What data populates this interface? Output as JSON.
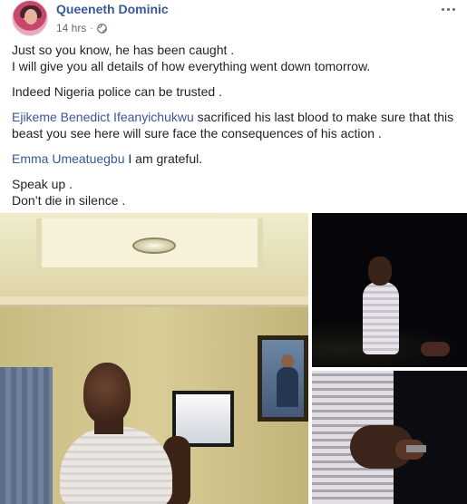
{
  "post": {
    "author": "Queeneth Dominic",
    "timestamp": "14 hrs",
    "separator": "·",
    "privacy_icon": "globe-icon",
    "more_icon": "more-options-icon",
    "body": {
      "p1_line1": "Just so you know, he has been caught .",
      "p1_line2": "I will give you all details of how everything went down tomorrow.",
      "p2": "Indeed Nigeria police can be trusted .",
      "p3_mention": "Ejikeme Benedict Ifeanyichukwu",
      "p3_text_a": " sacrificed his last blood to make sure that this",
      "p3_text_b": "beast you see here will sure face the consequences of his action .",
      "p4_mention": "Emma Umeatuegbu",
      "p4_text": " I am grateful.",
      "p5_line1": "Speak up .",
      "p5_line2": "Don’t die in silence ."
    }
  },
  "colors": {
    "link": "#385898",
    "text": "#1d2129",
    "meta": "#616770"
  }
}
